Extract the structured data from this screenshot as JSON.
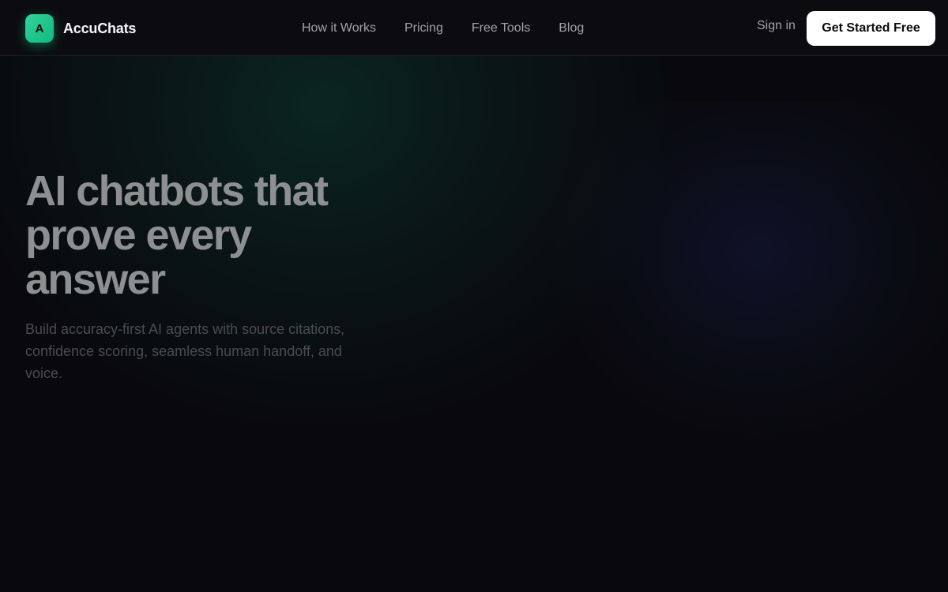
{
  "brand": {
    "logo_letter": "A",
    "name": "AccuChats"
  },
  "nav": {
    "items": [
      {
        "label": "How it Works"
      },
      {
        "label": "Pricing"
      },
      {
        "label": "Free Tools"
      },
      {
        "label": "Blog"
      }
    ]
  },
  "header_actions": {
    "signin_label": "Sign in",
    "cta_label": "Get Started Free"
  },
  "hero": {
    "title_line_1": "AI chatbots that",
    "title_line_2": "prove every",
    "title_line_3": "answer",
    "subtitle": "Build accuracy-first AI agents with source citations, confidence scoring, seamless human handoff, and voice."
  },
  "colors": {
    "background": "#09090d",
    "brand_accent": "#10b981",
    "cta_background": "#ffffff"
  }
}
